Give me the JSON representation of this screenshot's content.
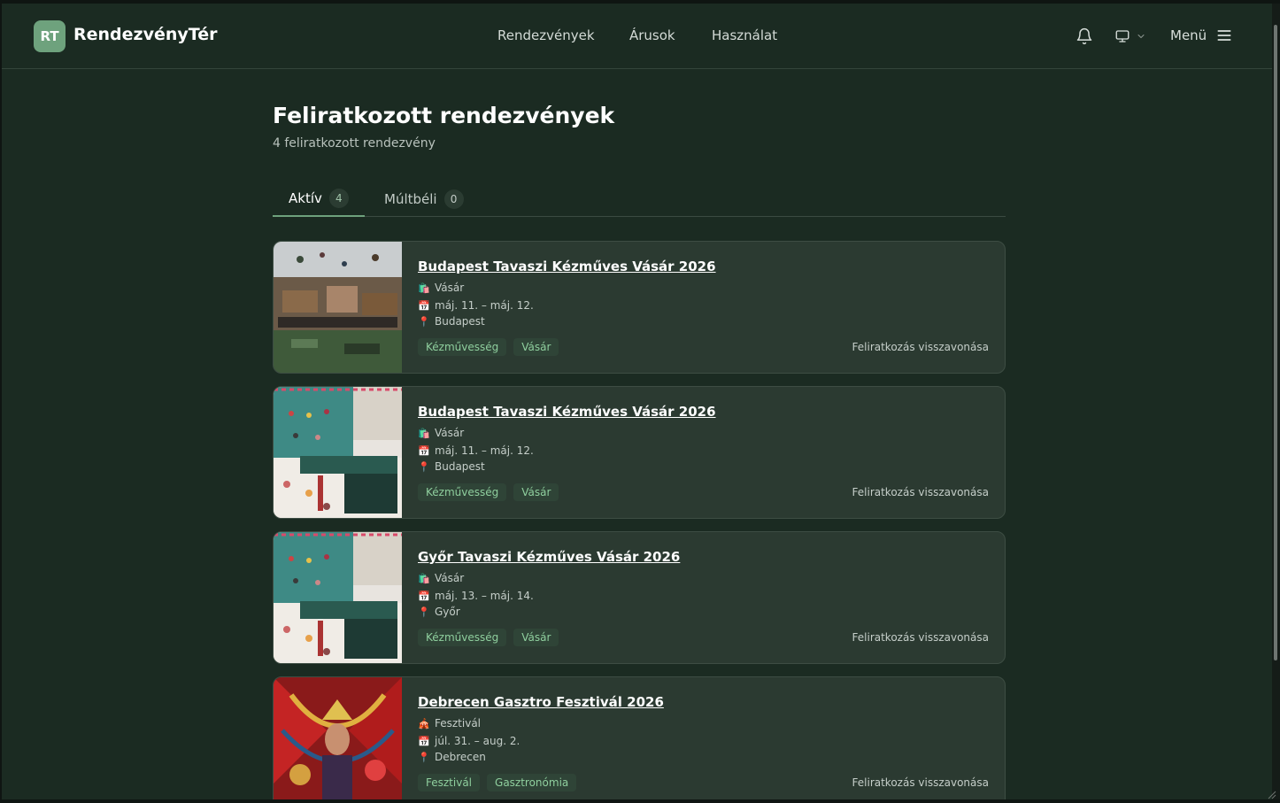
{
  "header": {
    "logo_initials": "RT",
    "brand": "RendezvényTér",
    "nav": [
      {
        "label": "Rendezvények"
      },
      {
        "label": "Árusok"
      },
      {
        "label": "Használat"
      }
    ],
    "menu_label": "Menü",
    "icons": [
      "bell-icon",
      "monitor-icon",
      "chevron-down-icon",
      "hamburger-icon"
    ]
  },
  "page": {
    "title": "Feliratkozott rendezvények",
    "subtitle": "4 feliratkozott rendezvény"
  },
  "tabs": [
    {
      "label": "Aktív",
      "count": "4",
      "active": true
    },
    {
      "label": "Múltbéli",
      "count": "0",
      "active": false
    }
  ],
  "events": [
    {
      "title": "Budapest Tavaszi Kézműves Vásár 2026",
      "type_icon": "🛍️",
      "type": "Vásár",
      "date_icon": "📅",
      "date": "máj. 11. – máj. 12.",
      "loc_icon": "📍",
      "location": "Budapest",
      "tags": [
        "Kézművesség",
        "Vásár"
      ],
      "action": "Feliratkozás visszavonása"
    },
    {
      "title": "Budapest Tavaszi Kézműves Vásár 2026",
      "type_icon": "🛍️",
      "type": "Vásár",
      "date_icon": "📅",
      "date": "máj. 11. – máj. 12.",
      "loc_icon": "📍",
      "location": "Budapest",
      "tags": [
        "Kézművesség",
        "Vásár"
      ],
      "action": "Feliratkozás visszavonása"
    },
    {
      "title": "Győr Tavaszi Kézműves Vásár 2026",
      "type_icon": "🛍️",
      "type": "Vásár",
      "date_icon": "📅",
      "date": "máj. 13. – máj. 14.",
      "loc_icon": "📍",
      "location": "Győr",
      "tags": [
        "Kézművesség",
        "Vásár"
      ],
      "action": "Feliratkozás visszavonása"
    },
    {
      "title": "Debrecen Gasztro Fesztivál 2026",
      "type_icon": "🎪",
      "type": "Fesztivál",
      "date_icon": "📅",
      "date": "júl. 31. – aug. 2.",
      "loc_icon": "📍",
      "location": "Debrecen",
      "tags": [
        "Fesztivál",
        "Gasztronómia"
      ],
      "action": "Feliratkozás visszavonása"
    }
  ],
  "colors": {
    "background": "#1b2b22",
    "card": "#2b3a31",
    "accent": "#6ea27d",
    "tag_text": "#8fcf9e"
  }
}
